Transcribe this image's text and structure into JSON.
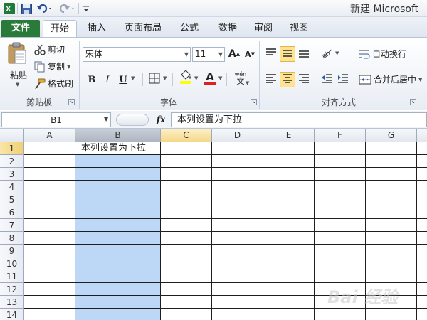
{
  "window": {
    "title": "新建 Microsoft"
  },
  "tabs": [
    "文件",
    "开始",
    "插入",
    "页面布局",
    "公式",
    "数据",
    "审阅",
    "视图"
  ],
  "clipboard": {
    "paste": "粘贴",
    "cut": "剪切",
    "copy": "复制",
    "format_painter": "格式刷",
    "label": "剪贴板"
  },
  "font": {
    "name": "宋体",
    "size": "11",
    "bold": "B",
    "italic": "I",
    "underline": "U",
    "grow": "A",
    "shrink": "A",
    "color_a": "A",
    "wen": "wén",
    "label": "字体"
  },
  "alignment": {
    "wrap": "自动换行",
    "merge": "合并后居中",
    "label": "对齐方式"
  },
  "formula_bar": {
    "name_box": "B1",
    "fx": "fx",
    "value": "本列设置为下拉"
  },
  "sheet": {
    "columns": [
      "A",
      "B",
      "C",
      "D",
      "E",
      "F",
      "G"
    ],
    "rows": [
      "1",
      "2",
      "3",
      "4",
      "5",
      "6",
      "7",
      "8",
      "9",
      "10",
      "11",
      "12",
      "13",
      "14"
    ],
    "cell_b1": "本列设置为下拉"
  },
  "watermark": "Bai 经验",
  "colors": {
    "accent_green": "#2a7a3a",
    "selection_blue": "#bdd7f7",
    "active_yellow": "#ffe391"
  }
}
